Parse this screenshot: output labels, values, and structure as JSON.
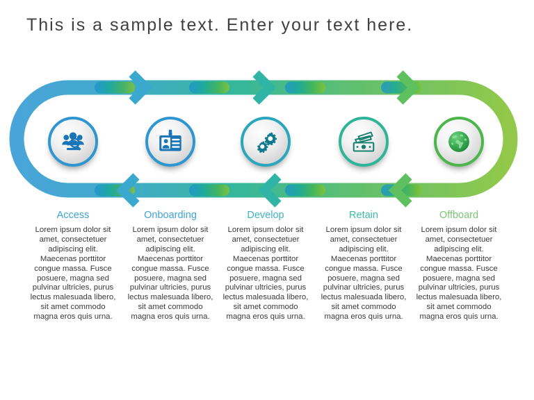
{
  "header": {
    "title": "This is a sample text. Enter your text here."
  },
  "diagram": {
    "type": "cyclic-process-loop",
    "direction_top": "right",
    "direction_bottom": "left",
    "track_gradient": [
      "#49a5d9",
      "#3fa9c4",
      "#36b79a",
      "#5cbf72",
      "#8dc63f"
    ],
    "steps": [
      {
        "index": 1,
        "label": "Access",
        "label_color": "#3ea3d6",
        "ring_color": "#2f96cf",
        "icon": "people-search-icon",
        "icon_color": "#1b76b8",
        "body": "Lorem ipsum dolor sit amet, consectetuer adipiscing elit. Maecenas porttitor congue massa. Fusce posuere, magna sed pulvinar ultricies, purus lectus malesuada libero, sit amet commodo magna eros quis urna."
      },
      {
        "index": 2,
        "label": "Onboarding",
        "label_color": "#3ea3d6",
        "ring_color": "#2f96cf",
        "icon": "id-badge-icon",
        "icon_color": "#1b76b8",
        "body": "Lorem ipsum dolor sit amet, consectetuer adipiscing elit. Maecenas porttitor congue massa. Fusce posuere, magna sed pulvinar ultricies, purus lectus malesuada libero, sit amet commodo magna eros quis urna."
      },
      {
        "index": 3,
        "label": "Develop",
        "label_color": "#3eb3c4",
        "ring_color": "#2ba6bd",
        "icon": "gears-icon",
        "icon_color": "#12798f",
        "body": "Lorem ipsum dolor sit amet, consectetuer adipiscing elit. Maecenas porttitor congue massa. Fusce posuere, magna sed pulvinar ultricies, purus lectus malesuada libero, sit amet commodo magna eros quis urna."
      },
      {
        "index": 4,
        "label": "Retain",
        "label_color": "#3dbda0",
        "ring_color": "#2eb597",
        "icon": "money-cash-icon",
        "icon_color": "#17806d",
        "body": "Lorem ipsum dolor sit amet, consectetuer adipiscing elit. Maecenas porttitor congue massa. Fusce posuere, magna sed pulvinar ultricies, purus lectus malesuada libero, sit amet commodo magna eros quis urna."
      },
      {
        "index": 5,
        "label": "Offboard",
        "label_color": "#7cc576",
        "ring_color": "#4cb64c",
        "icon": "globe-icon",
        "icon_color": "#2f9e43",
        "body": "Lorem ipsum dolor sit amet, consectetuer adipiscing elit. Maecenas porttitor congue massa. Fusce posuere, magna sed pulvinar ultricies, purus lectus malesuada libero, sit amet commodo magna eros quis urna."
      }
    ]
  }
}
